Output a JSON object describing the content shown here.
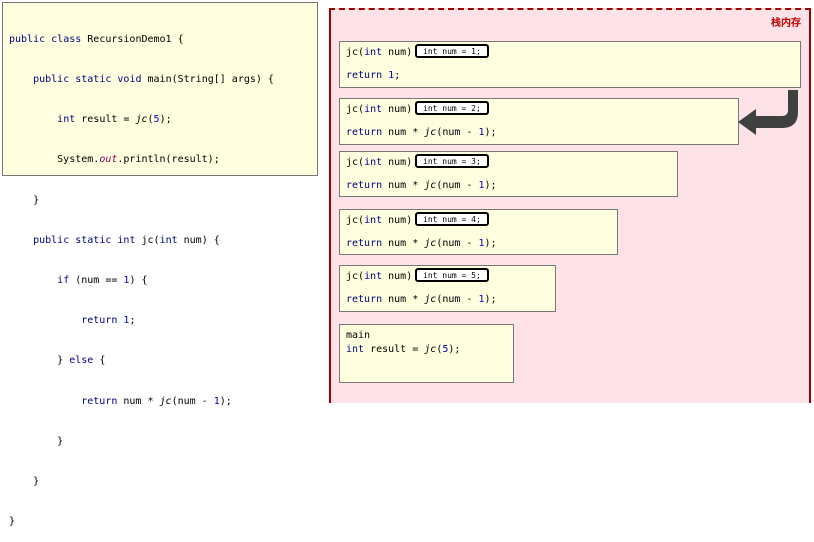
{
  "code": {
    "lines": [
      [
        "public",
        " ",
        "class",
        " RecursionDemo1 {"
      ],
      [
        "    ",
        "public",
        " ",
        "static",
        " ",
        "void",
        " main(String[] args) {"
      ],
      [
        "        ",
        "int",
        " result = ",
        "jc",
        "(",
        "5",
        ");"
      ],
      [
        "        System.",
        "out",
        ".println(result);"
      ],
      [
        "    }"
      ],
      [
        "    ",
        "public",
        " ",
        "static",
        " ",
        "int",
        " jc(",
        "int",
        " num) {"
      ],
      [
        "        ",
        "if",
        " (num == ",
        "1",
        ") {"
      ],
      [
        "            ",
        "return",
        " ",
        "1",
        ";"
      ],
      [
        "        } ",
        "else",
        " {"
      ],
      [
        "            ",
        "return",
        " num * ",
        "jc",
        "(num - ",
        "1",
        ");"
      ],
      [
        "        }"
      ],
      [
        "    }"
      ],
      [
        "}"
      ]
    ]
  },
  "stack": {
    "label": "栈内存",
    "frames": [
      {
        "sig_kw": "int",
        "sig_pre": "jc(",
        "sig_post": " num)",
        "badge": "int num = 1;",
        "ret_kw": "return",
        "ret_rest": " ",
        "ret_num": "1",
        "ret_end": ";",
        "recursive": false
      },
      {
        "sig_kw": "int",
        "sig_pre": "jc(",
        "sig_post": " num)",
        "badge": "int num = 2;",
        "ret_kw": "return",
        "ret_rest": " num * ",
        "ret_fn": "jc",
        "ret_mid": "(num - ",
        "ret_num": "1",
        "ret_end": ");",
        "recursive": true
      },
      {
        "sig_kw": "int",
        "sig_pre": "jc(",
        "sig_post": " num)",
        "badge": "int num = 3;",
        "ret_kw": "return",
        "ret_rest": " num * ",
        "ret_fn": "jc",
        "ret_mid": "(num - ",
        "ret_num": "1",
        "ret_end": ");",
        "recursive": true
      },
      {
        "sig_kw": "int",
        "sig_pre": "jc(",
        "sig_post": " num)",
        "badge": "int num = 4;",
        "ret_kw": "return",
        "ret_rest": " num * ",
        "ret_fn": "jc",
        "ret_mid": "(num - ",
        "ret_num": "1",
        "ret_end": ");",
        "recursive": true
      },
      {
        "sig_kw": "int",
        "sig_pre": "jc(",
        "sig_post": " num)",
        "badge": "int num = 5;",
        "ret_kw": "return",
        "ret_rest": " num * ",
        "ret_fn": "jc",
        "ret_mid": "(num - ",
        "ret_num": "1",
        "ret_end": ");",
        "recursive": true
      }
    ],
    "main_frame": {
      "title": "main",
      "line_kw": "int",
      "line_rest": " result = ",
      "line_fn": "jc",
      "line_open": "(",
      "line_num": "5",
      "line_end": ");"
    }
  },
  "colors": {
    "keyword": "#00007f",
    "number": "#0000c0",
    "stack_bg": "#fde3e8",
    "stack_border": "#a00000",
    "frame_bg": "#ffffe0",
    "arrow": "#404040"
  },
  "icons": {
    "return_arrow": "curved-arrow-icon"
  }
}
